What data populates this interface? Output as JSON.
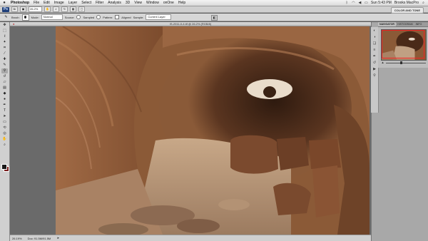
{
  "menubar": {
    "apple": "",
    "items": [
      "Photoshop",
      "File",
      "Edit",
      "Image",
      "Layer",
      "Select",
      "Filter",
      "Analysis",
      "3D",
      "View",
      "Window",
      "onOne",
      "Help"
    ],
    "clock": "Sun 5:43 PM",
    "user": "Brooks MacPro"
  },
  "appbar": {
    "logo": "Ps",
    "zoom": "26.2%",
    "workspace": "COLOR AND TONE"
  },
  "options": {
    "brush_label": "Brush:",
    "mode_label": "Mode:",
    "mode_value": "Normal",
    "source_label": "Source:",
    "sampled_label": "Sampled",
    "pattern_label": "Pattern:",
    "aligned_label": "Aligned",
    "sample_label": "Sample:",
    "sample_value": "Current Layer"
  },
  "document": {
    "title": "IS-2011-0-4.tif @ 26.2% (RGB/8)"
  },
  "status": {
    "zoom": "26.19%",
    "doc": "Doc: 91.5M/91.5M"
  },
  "navigator": {
    "tabs": [
      "NAVIGATOR",
      "HISTOGRAM",
      "INFO"
    ]
  },
  "colors": {
    "foreground": "#1a1a1a",
    "background": "#7a1f1f",
    "photo_base": "#8b5a37"
  }
}
